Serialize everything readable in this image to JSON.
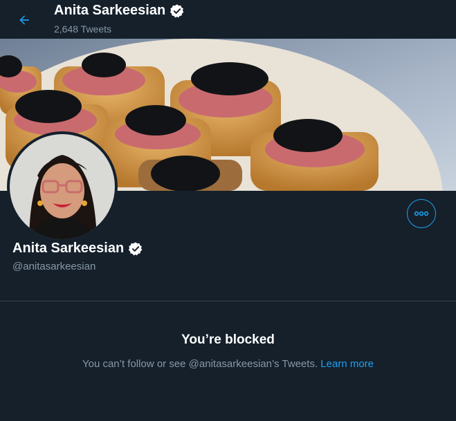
{
  "header": {
    "back_icon": "arrow-left-icon",
    "name": "Anita Sarkeesian",
    "verified_icon": "verified-badge-icon",
    "tweet_count": "2,648 Tweets"
  },
  "profile": {
    "name": "Anita Sarkeesian",
    "handle": "@anitasarkeesian",
    "more_icon": "more-options-icon"
  },
  "blocked": {
    "title": "You’re blocked",
    "message": "You can’t follow or see @anitasarkeesian’s Tweets.",
    "link": "Learn more"
  },
  "colors": {
    "background": "#15202b",
    "accent": "#1da1f2",
    "secondary_text": "#8899a6",
    "divider": "#38444d"
  }
}
